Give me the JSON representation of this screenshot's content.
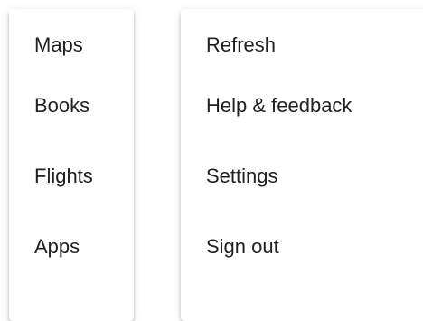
{
  "menus": {
    "left": {
      "items": [
        {
          "label": "Maps"
        },
        {
          "label": "Books"
        },
        {
          "label": "Flights"
        },
        {
          "label": "Apps"
        }
      ]
    },
    "right": {
      "items": [
        {
          "label": "Refresh"
        },
        {
          "label": "Help & feedback"
        },
        {
          "label": "Settings"
        },
        {
          "label": "Sign out"
        }
      ]
    }
  }
}
